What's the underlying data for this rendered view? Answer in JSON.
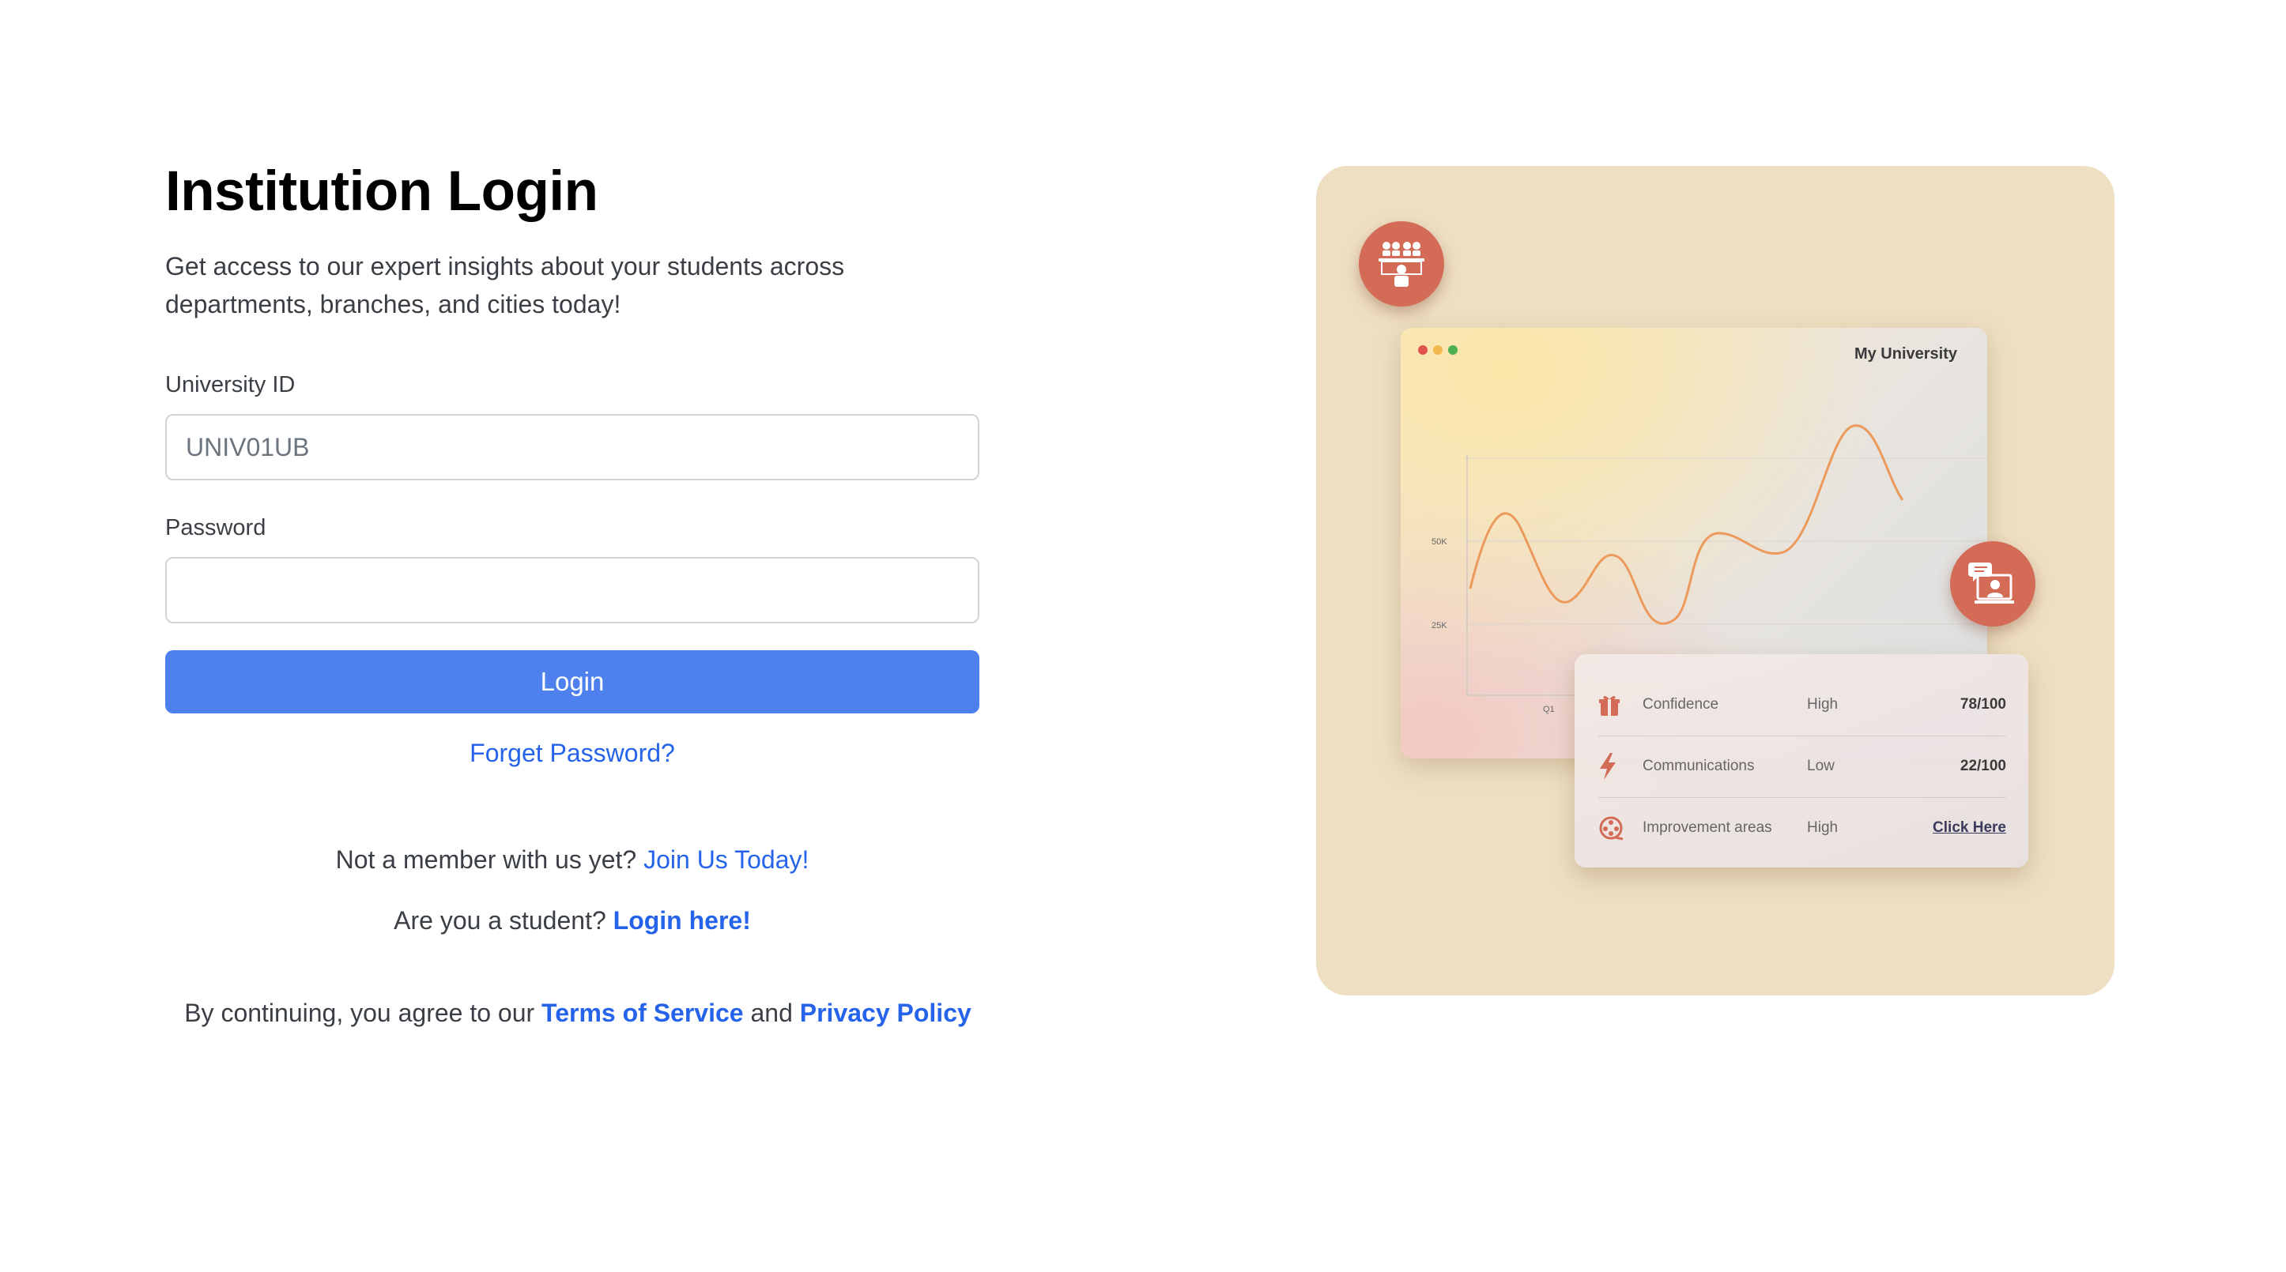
{
  "login": {
    "title": "Institution Login",
    "subtitle": "Get access to our expert insights about your students across departments, branches, and cities today!",
    "university_id_label": "University ID",
    "university_id_placeholder": "UNIV01UB",
    "password_label": "Password",
    "password_value": "",
    "login_button": "Login",
    "forgot_password": "Forget Password?",
    "member_prompt": "Not a member with us yet?",
    "join_link": "Join Us Today!",
    "student_prompt": "Are you a student?",
    "student_link": "Login here!",
    "terms_prefix": "By continuing, you agree to our",
    "terms_link": "Terms of Service",
    "terms_and": "and",
    "privacy_link": "Privacy Policy"
  },
  "illustration": {
    "window_title": "My University",
    "chart_y_ticks": [
      "50K",
      "25K"
    ],
    "chart_x_ticks": [
      "Q1"
    ],
    "window_dot_colors": [
      "#e0534b",
      "#f2b84b",
      "#4caf50"
    ],
    "accent_color": "#d36b56",
    "panel_background": "#efdfc2",
    "icons": [
      "classroom-icon",
      "online-tutor-icon"
    ],
    "stats": [
      {
        "icon": "gift-box-icon",
        "name": "Confidence",
        "level": "High",
        "value": "78/100"
      },
      {
        "icon": "lightning-icon",
        "name": "Communications",
        "level": "Low",
        "value": "22/100"
      },
      {
        "icon": "film-reel-icon",
        "name": "Improvement areas",
        "level": "High",
        "value": "Click Here"
      }
    ]
  },
  "colors": {
    "primary_button": "#4e81ee",
    "link": "#2563eb"
  }
}
